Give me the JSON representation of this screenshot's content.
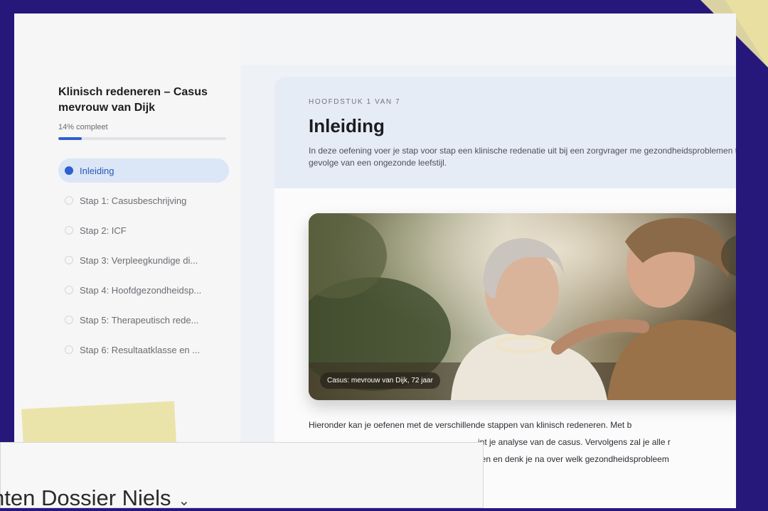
{
  "course": {
    "title": "Klinisch redeneren – Casus mevrouw van Dijk",
    "progress_label": "14% compleet",
    "progress_fraction": 0.14
  },
  "nav": {
    "items": [
      {
        "label": "Inleiding",
        "active": true
      },
      {
        "label": "Stap 1: Casusbeschrijving",
        "active": false
      },
      {
        "label": "Stap 2: ICF",
        "active": false
      },
      {
        "label": "Stap 3: Verpleegkundige di...",
        "active": false
      },
      {
        "label": "Stap 4: Hoofdgezondheidsp...",
        "active": false
      },
      {
        "label": "Stap 5: Therapeutisch rede...",
        "active": false
      },
      {
        "label": "Stap 6: Resultaatklasse en ...",
        "active": false
      }
    ]
  },
  "chapter": {
    "label": "HOOFDSTUK 1 VAN 7",
    "title": "Inleiding",
    "description": "In deze oefening voer je stap voor stap een klinische redenatie uit bij een zorgvrager me gezondheidsproblemen ten gevolge van een ongezonde leefstijl."
  },
  "photo": {
    "caption": "Casus: mevrouw van Dijk, 72 jaar"
  },
  "body": {
    "line1": "Hieronder kan je oefenen met de verschillende stappen van klinisch redeneren. Met b",
    "line2": "int je analyse van de casus. Vervolgens zal je alle r",
    "line3": "eren en denk je na over welk gezondheidsprobleem"
  },
  "overlay": {
    "title": "nten Dossier Niels",
    "chevron": "⌄"
  },
  "colors": {
    "background": "#25187a",
    "accent": "#2f5fd0",
    "tape": "#e9e2a3"
  }
}
